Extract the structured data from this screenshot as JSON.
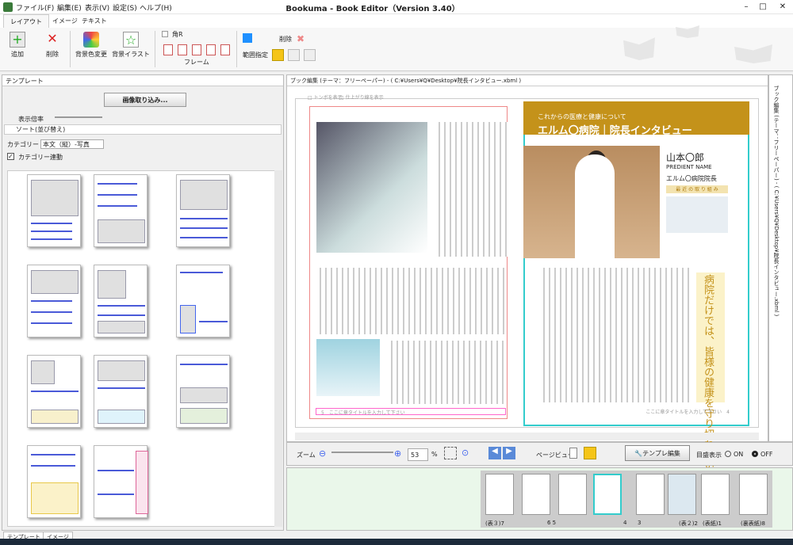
{
  "window": {
    "title": "Bookuma - Book Editor（Version 3.40）",
    "menu": [
      "ファイル(F)",
      "編集(E)",
      "表示(V)",
      "設定(S)",
      "ヘルプ(H)"
    ],
    "controls": [
      "–",
      "□",
      "✕"
    ]
  },
  "ribbon": {
    "tabs": [
      "レイアウト",
      "イメージ",
      "テキスト"
    ],
    "add": "追加",
    "delete": "削除",
    "bgcolor": "背景色変更",
    "bgillust": "背景イラスト",
    "kadoR": "角R",
    "frame": "フレーム",
    "range": "範囲指定",
    "delete2": "削除"
  },
  "left_panel": {
    "header": "テンプレート",
    "import_button": "画像取り込み...",
    "scale_label": "表示倍率",
    "sort": "ソート(並び替え)",
    "category_label": "カテゴリー",
    "category_value": "本文（縦）-写真",
    "category_link": "カテゴリー連動",
    "bottom_tabs": [
      "テンプレート",
      "イメージ"
    ]
  },
  "editor": {
    "header": "ブック編集 (テーマ：フリーペーパー) - ( C:¥Users¥Q¥Desktop¥院長インタビュー.xbml )",
    "side_label": "ブック編集 (テーマ：フリーペーパー) - ( C:¥Users¥Q¥Desktop¥院長インタビュー.xbml )",
    "top_marks": [
      "□ トンボを表示",
      "□ 仕上がり線を表示"
    ],
    "banner_sub": "これからの医療と健康について",
    "banner_main": "エルム〇病院｜院長インタビュー",
    "name": "山本〇郎",
    "name_role": "PREDIENT NAME",
    "name_hospital": "エルム〇病院院長",
    "recent": "最 近 の 取 り 組 み",
    "quote": "病院だけでは、皆様の健康を守り切れない時代",
    "footer_left": "ここに章タイトルを入力して下さい",
    "footer_right": "ここに章タイトルを入力して下さい",
    "page_left": "5",
    "page_right": "4"
  },
  "toolbar": {
    "zoom_label": "ズーム",
    "zoom_value": "53",
    "zoom_unit": "%",
    "page_view": "ページビュー",
    "template_edit": "テンプレ編集",
    "eye_display": "目盛表示",
    "on": "ON",
    "off": "OFF"
  },
  "page_strip": {
    "labels": [
      "(表３)7",
      "6 5",
      "4",
      "3",
      "(表２)2",
      "(表紙)1",
      "(裏表紙)8"
    ]
  }
}
